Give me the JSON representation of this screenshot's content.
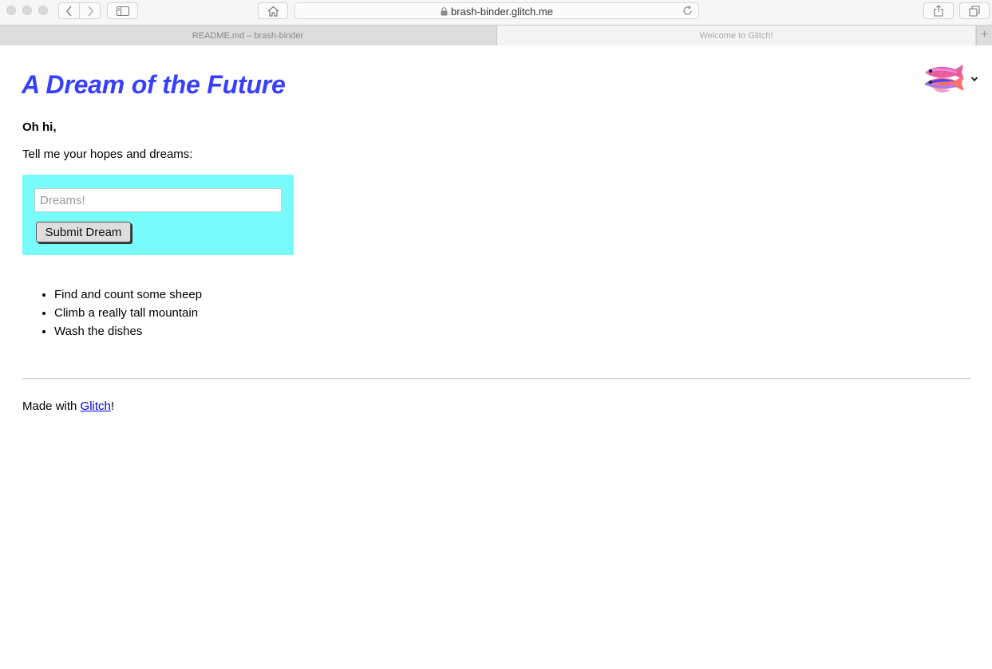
{
  "browser": {
    "url": "brash-binder.glitch.me",
    "tabs": [
      {
        "label": "README.md – brash-binder",
        "active": false
      },
      {
        "label": "Welcome to Glitch!",
        "active": true
      }
    ],
    "new_tab_label": "+"
  },
  "page": {
    "title": "A Dream of the Future",
    "greeting": "Oh hi,",
    "prompt": "Tell me your hopes and dreams:",
    "form": {
      "input_placeholder": "Dreams!",
      "input_value": "",
      "submit_label": "Submit Dream"
    },
    "dreams": [
      "Find and count some sheep",
      "Climb a really tall mountain",
      "Wash the dishes"
    ],
    "footer": {
      "prefix": "Made with ",
      "link_label": "Glitch",
      "suffix": "!"
    }
  },
  "colors": {
    "title": "#373fff",
    "form_background": "#77fcfb",
    "link": "#0000ee"
  },
  "icons": {
    "account": "glitch-fish-avatar-icon",
    "chevron": "chevron-down-icon"
  }
}
